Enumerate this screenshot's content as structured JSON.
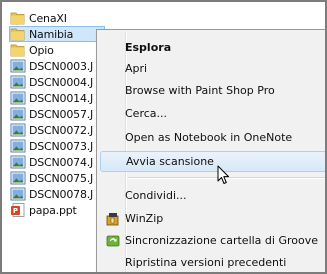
{
  "files": [
    {
      "name": "CenaXI",
      "type": "folder",
      "selected": false
    },
    {
      "name": "Namibia",
      "type": "folder",
      "selected": true
    },
    {
      "name": "Opio",
      "type": "folder",
      "selected": false
    },
    {
      "name": "DSCN0003.J",
      "type": "image",
      "selected": false
    },
    {
      "name": "DSCN0004.J",
      "type": "image",
      "selected": false
    },
    {
      "name": "DSCN0014.J",
      "type": "image",
      "selected": false
    },
    {
      "name": "DSCN0057.J",
      "type": "image",
      "selected": false
    },
    {
      "name": "DSCN0072.J",
      "type": "image",
      "selected": false
    },
    {
      "name": "DSCN0073.J",
      "type": "image",
      "selected": false
    },
    {
      "name": "DSCN0074.J",
      "type": "image",
      "selected": false
    },
    {
      "name": "DSCN0075.J",
      "type": "image",
      "selected": false
    },
    {
      "name": "DSCN0078.J",
      "type": "image",
      "selected": false
    },
    {
      "name": "papa.ppt",
      "type": "powerpoint",
      "selected": false
    }
  ],
  "context_menu": {
    "items": [
      {
        "label": "Esplora",
        "bold": true
      },
      {
        "label": "Apri"
      },
      {
        "label": "Browse with Paint Shop Pro"
      },
      {
        "label": "Cerca..."
      },
      {
        "label": "Open as Notebook in OneNote"
      },
      {
        "label": "Avvia scansione",
        "highlighted": true
      },
      {
        "label": "Condividi..."
      },
      {
        "label": "WinZip",
        "icon": "winzip-icon"
      },
      {
        "label": "Sincronizzazione cartella di Groove",
        "icon": "groove-sync-icon"
      },
      {
        "label": "Ripristina versioni precedenti"
      }
    ]
  },
  "colors": {
    "selection_bg": "#cfe6fb",
    "menu_bg": "#f1f1f1",
    "menu_highlight": "#d7e8f8",
    "folder_yellow": "#e8c04a"
  }
}
